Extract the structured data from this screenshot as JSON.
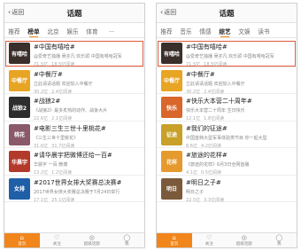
{
  "colors": {
    "accent": "#f0861c",
    "highlight": "#e05a3a"
  },
  "screens": [
    {
      "nav": {
        "back": "返回",
        "title": "话题"
      },
      "tabs": [
        "推荐",
        "榜单",
        "北京",
        "娱乐",
        "体育",
        "..."
      ],
      "active_tab": 1,
      "rows": [
        {
          "title": "#中国有嘻哈#",
          "desc": "@爱奇艺独播 吴亦凡 欢乐颂 中国有嘻哈冠军",
          "reads": "71.5亿",
          "discuss": "18.5亿阅读",
          "thumb_text": "有嘻哈",
          "thumb_color": "#3a2f2a",
          "highlight": true
        },
        {
          "title": "#中餐厅#",
          "desc": "立此请请话题 欢迎加入中餐厅",
          "reads": "30.2亿",
          "discuss": "2.4亿阅读",
          "thumb_text": "中餐厅",
          "thumb_color": "#e8a423",
          "highlight": false
        },
        {
          "title": "#战狼2#",
          "desc": "《战狼2》最多炙热的动作、战争大片",
          "reads": "22.6亿",
          "discuss": "2.1亿阅读",
          "thumb_text": "战狼2",
          "thumb_color": "#2e2e2e",
          "highlight": false
        },
        {
          "title": "#电影三生三世十里桃花#",
          "desc": "《三生三世十里桃花》",
          "reads": "31.6亿",
          "discuss": "31.7亿阅读",
          "thumb_text": "桃花",
          "thumb_color": "#8a5a6a",
          "highlight": false
        },
        {
          "title": "#请华晨宇把微博还给一百#",
          "desc": "华晨宇 一百 微博",
          "reads": "13.2亿",
          "discuss": "1.2亿阅读",
          "thumb_text": "华晨宇",
          "thumb_color": "#b33a2a",
          "highlight": false
        },
        {
          "title": "#2017世界女排大奖赛总决赛#",
          "desc": "2017世界女排大奖赛总决赛于7月24日举行",
          "reads": "17.1亿",
          "discuss": "25.1亿阅读",
          "thumb_text": "女排",
          "thumb_color": "#1f5fa8",
          "highlight": false
        }
      ],
      "bottom": [
        "首页",
        "关注",
        "超级话题",
        "我"
      ],
      "bottom_icons": [
        "⌂",
        "♡",
        "◎",
        "◯"
      ],
      "bottom_active": 0
    },
    {
      "nav": {
        "back": "返回",
        "title": "话题"
      },
      "tabs": [
        "推荐",
        "音乐",
        "情感",
        "综艺",
        "文娱",
        "读书"
      ],
      "active_tab": 3,
      "rows": [
        {
          "title": "#中国有嘻哈#",
          "desc": "@爱奇艺独播 吴亦凡 欢乐颂 中国有嘻哈冠军",
          "reads": "71.5亿",
          "discuss": "18.5亿阅读",
          "thumb_text": "有嘻哈",
          "thumb_color": "#3a2f2a",
          "highlight": true
        },
        {
          "title": "#中餐厅#",
          "desc": "立此请请话题 欢迎加入中餐厅",
          "reads": "30.2亿",
          "discuss": "2.4亿阅读",
          "thumb_text": "中餐厅",
          "thumb_color": "#e8a423",
          "highlight": false
        },
        {
          "title": "#快乐大本营二十周年#",
          "desc": "快乐大本营二十周年 生日快乐",
          "reads": "12.1亿",
          "discuss": "1.8亿阅读",
          "thumb_text": "快乐",
          "thumb_color": "#d9662a",
          "highlight": false
        },
        {
          "title": "#我们的征途#",
          "desc": "中国首档大型军事体验类节目 你一起大型",
          "reads": "8.6亿",
          "discuss": "4.2亿阅读",
          "thumb_text": "征途",
          "thumb_color": "#c8a02a",
          "highlight": false
        },
        {
          "title": "#旅途的花样#",
          "desc": "《旅途的花样》6月3日全网首播",
          "reads": "4.1亿",
          "discuss": "0.5亿阅读",
          "thumb_text": "花样",
          "thumb_color": "#e69a2e",
          "highlight": false
        },
        {
          "title": "#明日之子#",
          "desc": "明日之子",
          "reads": "22.5亿",
          "discuss": "3.3亿阅读",
          "thumb_text": "明日",
          "thumb_color": "#7a5a3a",
          "highlight": false
        }
      ],
      "bottom": [
        "首页",
        "关注",
        "超级话题",
        "我"
      ],
      "bottom_icons": [
        "⌂",
        "♡",
        "◎",
        "◯"
      ],
      "bottom_active": 0
    }
  ]
}
